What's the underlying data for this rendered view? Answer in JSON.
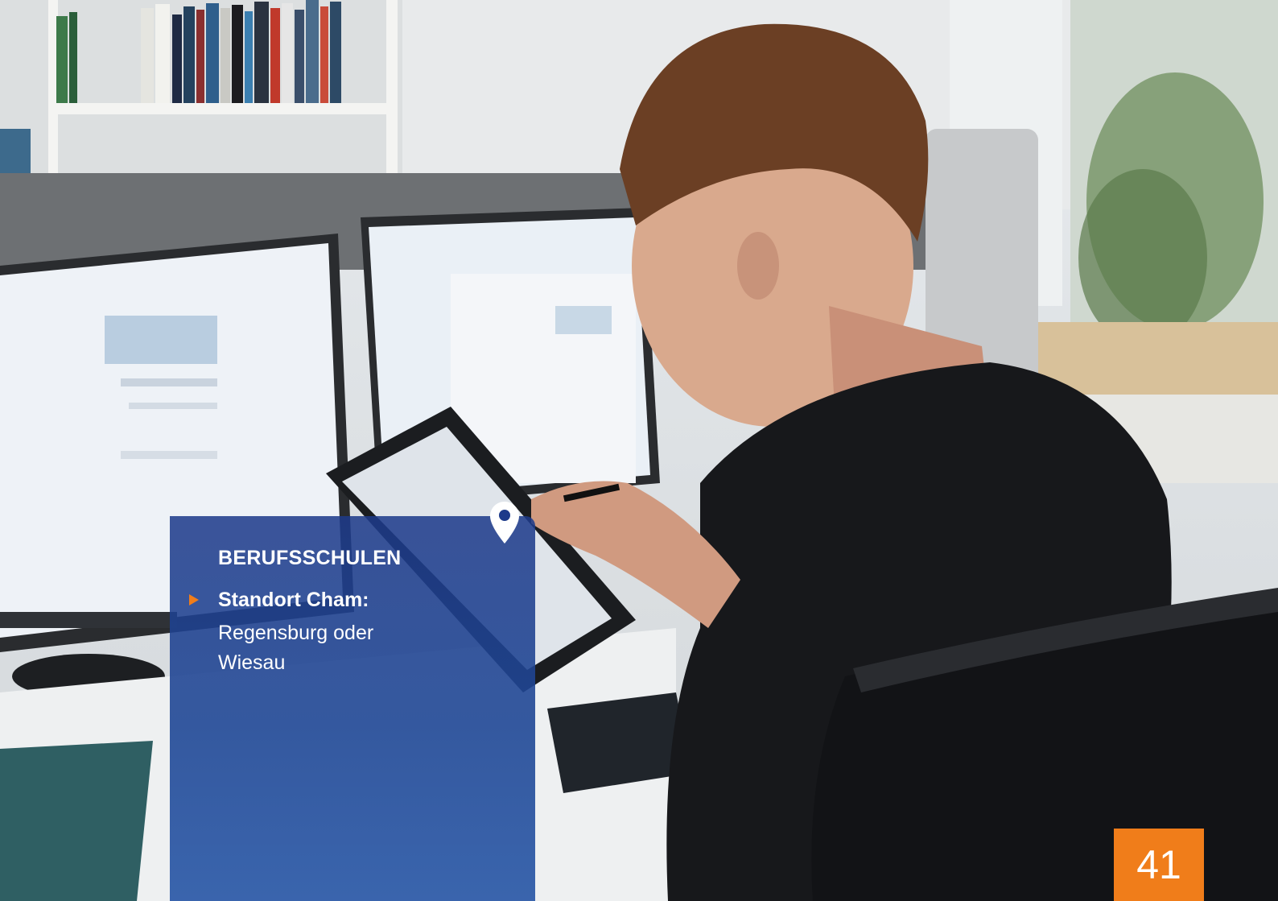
{
  "section": {
    "heading": "BERUFSSCHULEN",
    "location_label": "Standort Cham:",
    "location_text": "Regensburg oder Wiesau"
  },
  "page_number": "41",
  "colors": {
    "accent": "#f07d1a",
    "panel": "#1d3a8a"
  },
  "icons": {
    "pin": "location-pin-icon",
    "bullet": "play-triangle-icon"
  }
}
